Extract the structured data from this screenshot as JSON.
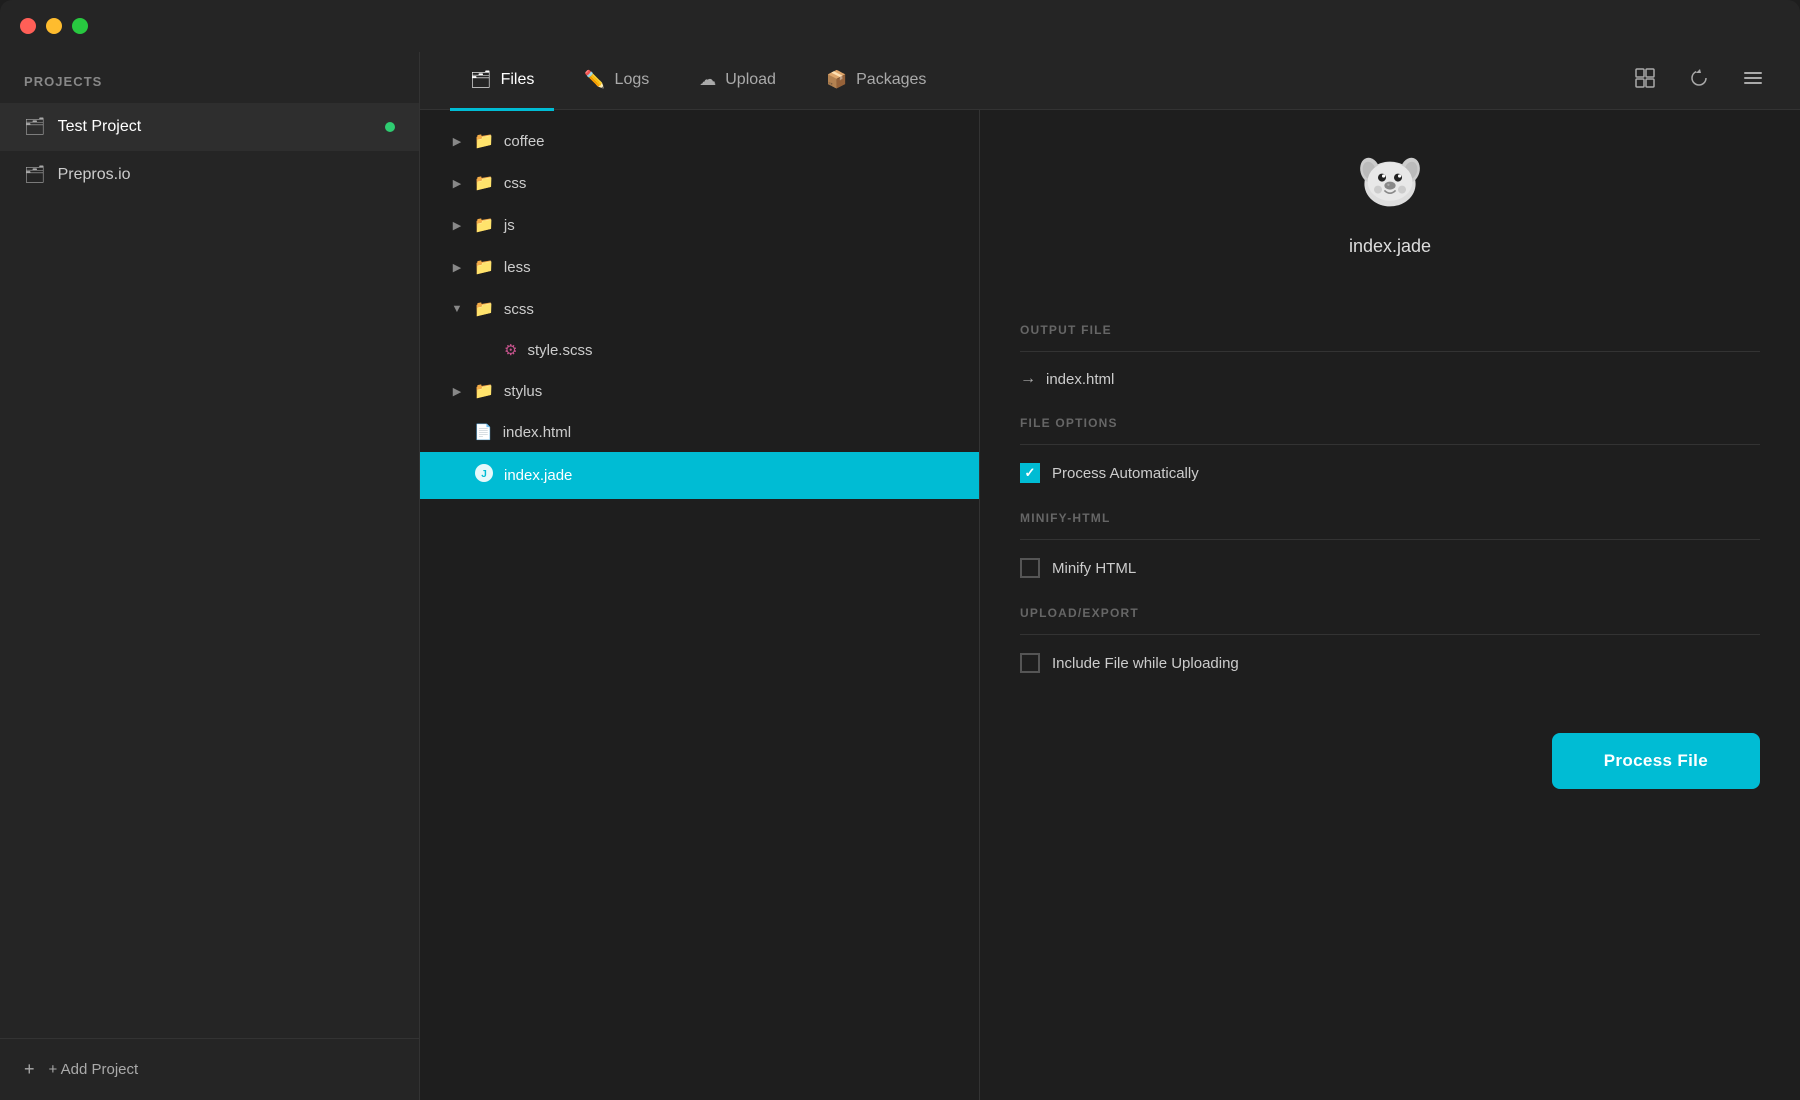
{
  "titlebar": {
    "traffic_lights": [
      "red",
      "yellow",
      "green"
    ]
  },
  "sidebar": {
    "header": "PROJECTS",
    "projects": [
      {
        "id": "test-project",
        "label": "Test Project",
        "active": true,
        "dot": true
      },
      {
        "id": "prepros-io",
        "label": "Prepros.io",
        "active": false,
        "dot": false
      }
    ],
    "add_button": "+ Add Project"
  },
  "tabs": {
    "items": [
      {
        "id": "files",
        "label": "Files",
        "active": true,
        "icon": "folder"
      },
      {
        "id": "logs",
        "label": "Logs",
        "active": false,
        "icon": "pen"
      },
      {
        "id": "upload",
        "label": "Upload",
        "active": false,
        "icon": "cloud"
      },
      {
        "id": "packages",
        "label": "Packages",
        "active": false,
        "icon": "box"
      }
    ],
    "toolbar_icons": [
      "grid-icon",
      "refresh-icon",
      "menu-icon"
    ]
  },
  "file_tree": {
    "items": [
      {
        "id": "coffee",
        "type": "folder",
        "label": "coffee",
        "indent": 0,
        "expanded": false,
        "chevron": "▶"
      },
      {
        "id": "css",
        "type": "folder",
        "label": "css",
        "indent": 0,
        "expanded": false,
        "chevron": "▶"
      },
      {
        "id": "js",
        "type": "folder",
        "label": "js",
        "indent": 0,
        "expanded": false,
        "chevron": "▶"
      },
      {
        "id": "less",
        "type": "folder",
        "label": "less",
        "indent": 0,
        "expanded": false,
        "chevron": "▶"
      },
      {
        "id": "scss",
        "type": "folder",
        "label": "scss",
        "indent": 0,
        "expanded": true,
        "chevron": "▼"
      },
      {
        "id": "style-scss",
        "type": "scss",
        "label": "style.scss",
        "indent": 1,
        "expanded": false,
        "chevron": ""
      },
      {
        "id": "stylus",
        "type": "folder",
        "label": "stylus",
        "indent": 0,
        "expanded": false,
        "chevron": "▶"
      },
      {
        "id": "index-html",
        "type": "html",
        "label": "index.html",
        "indent": 0,
        "expanded": false,
        "chevron": ""
      },
      {
        "id": "index-jade",
        "type": "jade",
        "label": "index.jade",
        "indent": 0,
        "expanded": false,
        "chevron": "",
        "selected": true
      }
    ]
  },
  "detail": {
    "file_name": "index.jade",
    "output_file_label": "OUTPUT FILE",
    "output_file_value": "index.html",
    "file_options_label": "FILE OPTIONS",
    "process_auto_label": "Process Automatically",
    "process_auto_checked": true,
    "minify_html_label": "MINIFY-HTML",
    "minify_html_option": "Minify HTML",
    "minify_html_checked": false,
    "upload_export_label": "UPLOAD/EXPORT",
    "include_file_label": "Include File while Uploading",
    "include_file_checked": false,
    "process_button": "Process File"
  }
}
